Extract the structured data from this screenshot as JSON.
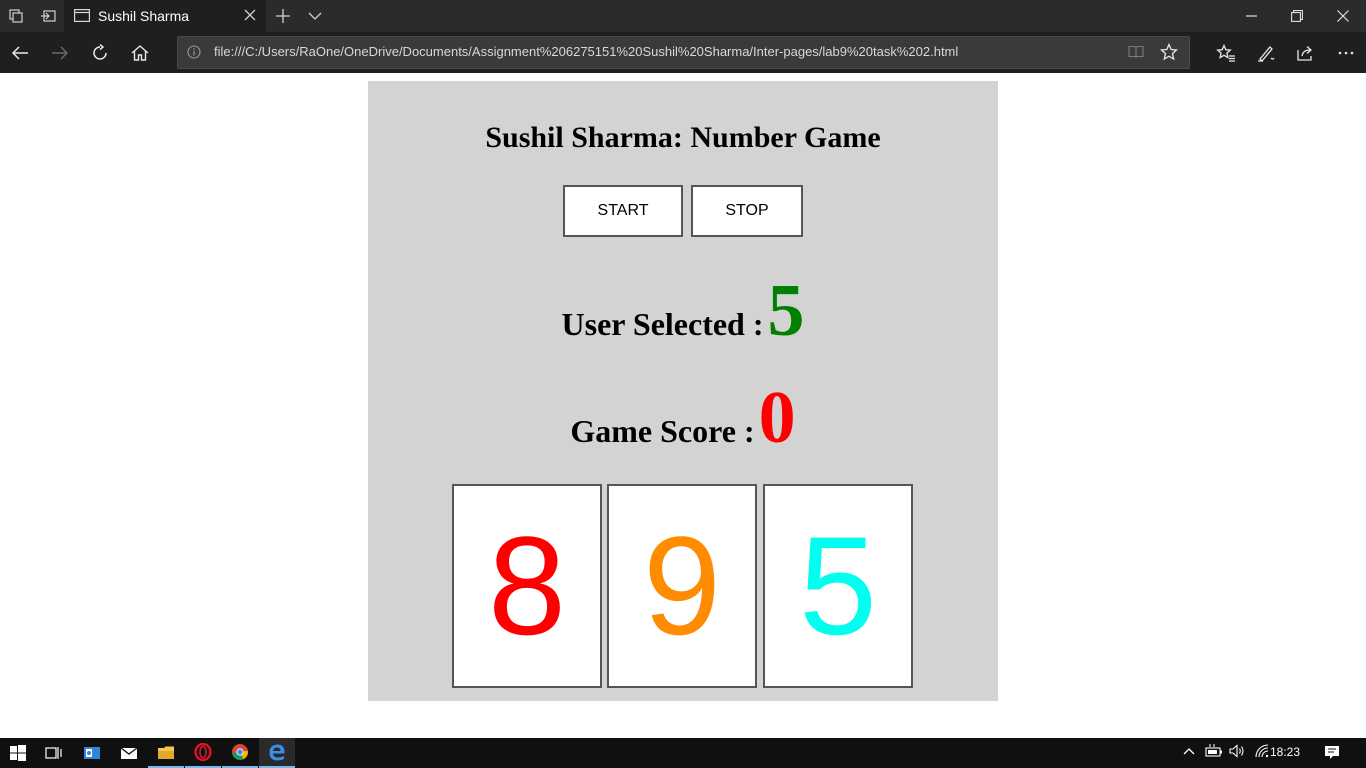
{
  "browser": {
    "tab_title": "Sushil Sharma",
    "url": "file:///C:/Users/RaOne/OneDrive/Documents/Assignment%206275151%20Sushil%20Sharma/Inter-pages/lab9%20task%202.html"
  },
  "game": {
    "title": "Sushil Sharma: Number Game",
    "start_label": "START",
    "stop_label": "STOP",
    "user_selected_label": "User Selected :",
    "user_selected_value": "5",
    "score_label": "Game Score :",
    "score_value": "0",
    "cards": [
      "8",
      "9",
      "5"
    ],
    "colors": {
      "panel": "#d3d3d3",
      "user_selected": "#008000",
      "score": "#ff0000",
      "card1": "#ff0000",
      "card2": "#ff8c00",
      "card3": "#00ffee"
    }
  },
  "taskbar": {
    "time": "18:23",
    "apps": [
      "start-icon",
      "task-view-icon",
      "outlook-icon",
      "mail-icon",
      "file-explorer-icon",
      "opera-icon",
      "chrome-icon",
      "edge-icon"
    ]
  }
}
